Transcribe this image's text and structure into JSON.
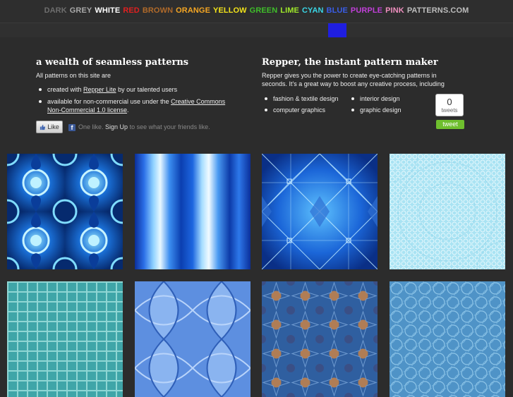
{
  "nav": {
    "items": [
      {
        "label": "DARK",
        "color": "#6e6e6e"
      },
      {
        "label": "GREY",
        "color": "#a9a9a9"
      },
      {
        "label": "WHITE",
        "color": "#ffffff"
      },
      {
        "label": "RED",
        "color": "#e02020"
      },
      {
        "label": "BROWN",
        "color": "#b06a2a"
      },
      {
        "label": "ORANGE",
        "color": "#f5a623"
      },
      {
        "label": "YELLOW",
        "color": "#f2e31a"
      },
      {
        "label": "GREEN",
        "color": "#3fbf2a"
      },
      {
        "label": "LIME",
        "color": "#9fe82a"
      },
      {
        "label": "CYAN",
        "color": "#3ad6e6"
      },
      {
        "label": "BLUE",
        "color": "#3a5ee8"
      },
      {
        "label": "PURPLE",
        "color": "#c040d8"
      },
      {
        "label": "PINK",
        "color": "#f090c0"
      },
      {
        "label": "PATTERNS.COM",
        "color": "#bdbdbd"
      }
    ]
  },
  "left": {
    "title": "a wealth of seamless patterns",
    "intro": "All patterns on this site are",
    "bullet1_pre": "created with ",
    "bullet1_link": "Repper Lite",
    "bullet1_post": " by our talented users",
    "bullet2_pre": "available for non-commercial use under the ",
    "bullet2_link": "Creative Commons Non-Commercial 1.0 license",
    "bullet2_post": "."
  },
  "right": {
    "title": "Repper, the instant pattern maker",
    "intro": "Repper gives you the power to create eye-catching patterns in seconds. It's a great way to boost any creative process, including",
    "features": [
      "fashion & textile design",
      "interior design",
      "computer graphics",
      "graphic design"
    ]
  },
  "facebook": {
    "like_label": "Like",
    "text_pre": "One like. ",
    "signup": "Sign Up",
    "text_post": " to see what your friends like."
  },
  "twitter": {
    "count": "0",
    "count_label": "tweets",
    "button": "tweet"
  }
}
